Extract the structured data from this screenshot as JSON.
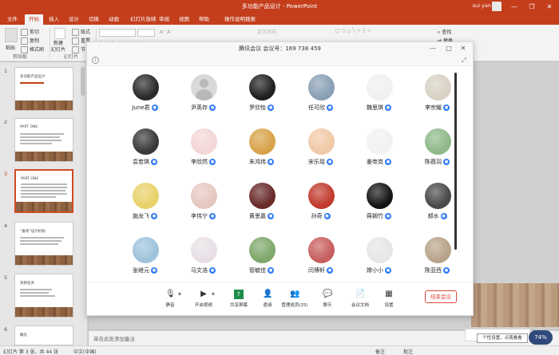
{
  "window": {
    "title": "多功能产品设计 - PowerPoint",
    "user": "sui yan",
    "min": "—",
    "max": "❐",
    "close": "✕"
  },
  "tabs": [
    "文件",
    "开始",
    "插入",
    "设计",
    "切换",
    "动画",
    "幻灯片放映",
    "审阅",
    "视图",
    "帮助",
    "操作说明搜索"
  ],
  "ribbon": {
    "paste": "粘贴",
    "cut": "剪切",
    "copy": "复制",
    "format_painter": "格式刷",
    "clipboard_group": "剪贴板",
    "new_slide": "新建\n幻灯片",
    "layout": "版式",
    "reset": "重置",
    "section": "节",
    "slides_group": "幻灯片",
    "text_direction": "文字方向",
    "find": "查找",
    "replace": "替换",
    "select": "选择"
  },
  "meeting": {
    "title": "腾讯会议 会议号：169 738 459",
    "participants": [
      {
        "name": "June君",
        "avatar": "photo",
        "color": "#2b2b2b"
      },
      {
        "name": "尹英存",
        "avatar": "default",
        "color": "#d9d9d9"
      },
      {
        "name": "罗欣怡",
        "avatar": "photo",
        "color": "#202020"
      },
      {
        "name": "任可欣",
        "avatar": "photo",
        "color": "#8aa0b5"
      },
      {
        "name": "魏思琪",
        "avatar": "photo",
        "color": "#f0f0f0"
      },
      {
        "name": "李宗耀",
        "avatar": "photo",
        "color": "#d8d1c4"
      },
      {
        "name": "袁若琪",
        "avatar": "photo",
        "color": "#3a3a3a"
      },
      {
        "name": "李欣然",
        "avatar": "photo",
        "color": "#f4d6d6"
      },
      {
        "name": "朱鸿伟",
        "avatar": "photo",
        "color": "#d8a24a"
      },
      {
        "name": "宋乐瑶",
        "avatar": "photo",
        "color": "#f1c9a6"
      },
      {
        "name": "姜帝岚",
        "avatar": "photo",
        "color": "#f2f2f2"
      },
      {
        "name": "陈薇羽",
        "avatar": "photo",
        "color": "#8fb88a"
      },
      {
        "name": "施龙飞",
        "avatar": "photo",
        "color": "#e8d26a"
      },
      {
        "name": "李伟宁",
        "avatar": "photo",
        "color": "#e6c7c0"
      },
      {
        "name": "黄思嘉",
        "avatar": "photo",
        "color": "#6a2a2a"
      },
      {
        "name": "孙奇",
        "avatar": "photo",
        "color": "#c23b2e"
      },
      {
        "name": "蒋娴竹",
        "avatar": "photo",
        "color": "#151515"
      },
      {
        "name": "郝水",
        "avatar": "photo",
        "color": "#4a4a4a"
      },
      {
        "name": "张继元",
        "avatar": "photo",
        "color": "#9fc3dc"
      },
      {
        "name": "马文浩",
        "avatar": "photo",
        "color": "#e8e0e6"
      },
      {
        "name": "管毓佳",
        "avatar": "photo",
        "color": "#7fa86a"
      },
      {
        "name": "闫博轩",
        "avatar": "photo",
        "color": "#c85f5f"
      },
      {
        "name": "嫦小小",
        "avatar": "photo",
        "color": "#e6e6e6"
      },
      {
        "name": "陈亚西",
        "avatar": "photo",
        "color": "#b8a48a"
      }
    ],
    "toolbar": {
      "mute": "静音",
      "video": "开启视频",
      "share": "共享屏幕",
      "invite": "邀请",
      "members": "管理成员(25)",
      "chat": "聊天",
      "docs": "会议文档",
      "settings": "设置",
      "end": "结束会议"
    }
  },
  "slides": [
    {
      "num": "1",
      "title": "多功能产品设计"
    },
    {
      "num": "2",
      "title": "PART ONE"
    },
    {
      "num": "3",
      "title": "PART ONE"
    },
    {
      "num": "4",
      "title": "“备装”设计机构"
    },
    {
      "num": "5",
      "title": "项目任务"
    },
    {
      "num": "6",
      "title": "概念"
    }
  ],
  "notes_placeholder": "单击此处添加备注",
  "status": {
    "slide_info": "幻灯片 第 3 张，共 44 张",
    "language": "中文(中国)",
    "notes": "备注",
    "comments": "批注",
    "zoom": "74%",
    "tray_tip": "个性设置，点我看看"
  }
}
